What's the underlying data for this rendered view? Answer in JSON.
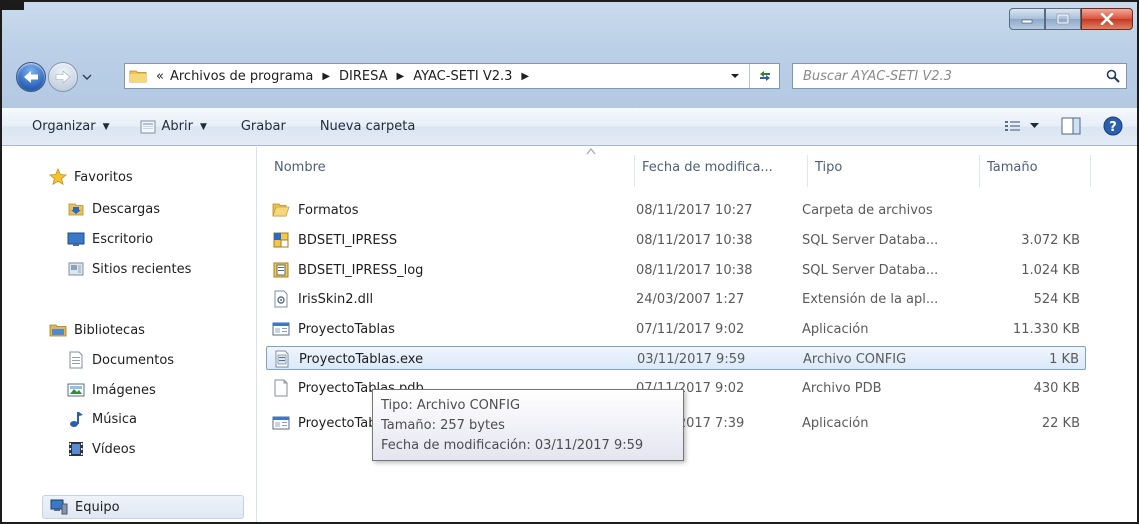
{
  "window": {
    "minimize_label": "–",
    "maximize_label": "□",
    "close_label": "X"
  },
  "address": {
    "overflow": "«",
    "segments": [
      "Archivos de programa",
      "DIRESA",
      "AYAC-SETI V2.3"
    ],
    "separator": "▶"
  },
  "search": {
    "placeholder": "Buscar AYAC-SETI V2.3"
  },
  "toolbar": {
    "organize_label": "Organizar",
    "open_label": "Abrir",
    "burn_label": "Grabar",
    "new_folder_label": "Nueva carpeta"
  },
  "sidebar": {
    "favorites": "Favoritos",
    "downloads": "Descargas",
    "desktop": "Escritorio",
    "recent": "Sitios recientes",
    "libraries": "Bibliotecas",
    "documents": "Documentos",
    "pictures": "Imágenes",
    "music": "Música",
    "videos": "Vídeos",
    "computer": "Equipo"
  },
  "columns": {
    "name": "Nombre",
    "date": "Fecha de modifica...",
    "type": "Tipo",
    "size": "Tamaño"
  },
  "files": [
    {
      "name": "Formatos",
      "date": "08/11/2017 10:27",
      "type": "Carpeta de archivos",
      "size": "",
      "icon": "folder-icon"
    },
    {
      "name": "BDSETI_IPRESS",
      "date": "08/11/2017 10:38",
      "type": "SQL Server Databa...",
      "size": "3.072 KB",
      "icon": "database-icon"
    },
    {
      "name": "BDSETI_IPRESS_log",
      "date": "08/11/2017 10:38",
      "type": "SQL Server Databa...",
      "size": "1.024 KB",
      "icon": "database-log-icon"
    },
    {
      "name": "IrisSkin2.dll",
      "date": "24/03/2007 1:27",
      "type": "Extensión de la apl...",
      "size": "524 KB",
      "icon": "dll-icon"
    },
    {
      "name": "ProyectoTablas",
      "date": "07/11/2017 9:02",
      "type": "Aplicación",
      "size": "11.330 KB",
      "icon": "application-icon"
    },
    {
      "name": "ProyectoTablas.exe",
      "date": "03/11/2017 9:59",
      "type": "Archivo CONFIG",
      "size": "1 KB",
      "icon": "config-file-icon"
    },
    {
      "name": "ProyectoTablas.pdb",
      "date": "07/11/2017 9:02",
      "type": "Archivo PDB",
      "size": "430 KB",
      "icon": "blank-file-icon"
    },
    {
      "name": "ProyectoTablas.vshost",
      "date": "07/11/2017 7:39",
      "type": "Aplicación",
      "size": "22 KB",
      "icon": "application-icon"
    }
  ],
  "tooltip": {
    "type": "Tipo: Archivo CONFIG",
    "size": "Tamaño: 257 bytes",
    "modified": "Fecha de modificación: 03/11/2017 9:59"
  }
}
